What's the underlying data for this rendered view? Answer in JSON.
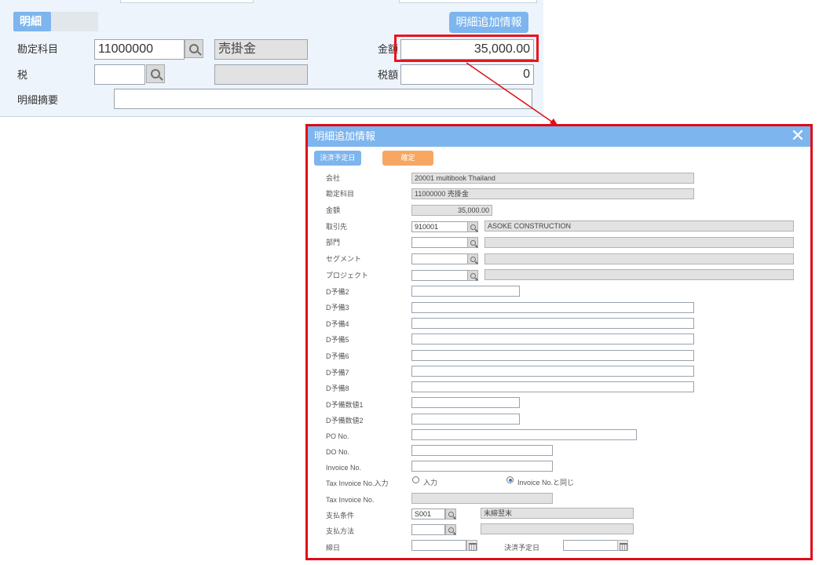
{
  "detail_panel": {
    "tab_label": "明細",
    "extra_info_button": "明細追加情報",
    "account_label": "勘定科目",
    "account_code": "11000000",
    "account_name": "売掛金",
    "amount_label": "金額",
    "amount_value": "35,000.00",
    "tax_label": "税",
    "tax_code": "",
    "tax_name": "",
    "tax_amount_label": "税額",
    "tax_amount_value": "0",
    "memo_label": "明細摘要",
    "memo_value": ""
  },
  "dialog": {
    "title": "明細追加情報",
    "close_icon": "close-icon",
    "date_button": "決済予定日",
    "confirm_button": "確定",
    "company_label": "会社",
    "company_value": "20001 multibook Thailand",
    "account_label": "勘定科目",
    "account_value": "11000000 売掛金",
    "amount_label": "金額",
    "amount_value": "35,000.00",
    "partner_label": "取引先",
    "partner_code": "910001",
    "partner_name": "ASOKE CONSTRUCTION",
    "dept_label": "部門",
    "segment_label": "セグメント",
    "project_label": "プロジェクト",
    "d2_label": "D予備2",
    "d3_label": "D予備3",
    "d4_label": "D予備4",
    "d5_label": "D予備5",
    "d6_label": "D予備6",
    "d7_label": "D予備7",
    "d8_label": "D予備8",
    "dn1_label": "D予備数値1",
    "dn2_label": "D予備数値2",
    "po_label": "PO No.",
    "do_label": "DO No.",
    "invoice_label": "Invoice No.",
    "tax_invoice_input_label": "Tax Invoice No.入力",
    "radio_input": "入力",
    "radio_same": "Invoice No.と同じ",
    "radio_selected": "same",
    "tax_invoice_label": "Tax Invoice No.",
    "payment_terms_label": "支払条件",
    "payment_terms_code": "S001",
    "payment_terms_name": "末締翌末",
    "payment_method_label": "支払方法",
    "closing_date_label": "締日",
    "settlement_date_label": "決済予定日"
  },
  "colors": {
    "accent_blue": "#7db5ee",
    "confirm_orange": "#f7a762",
    "highlight_red": "#e00b16"
  }
}
